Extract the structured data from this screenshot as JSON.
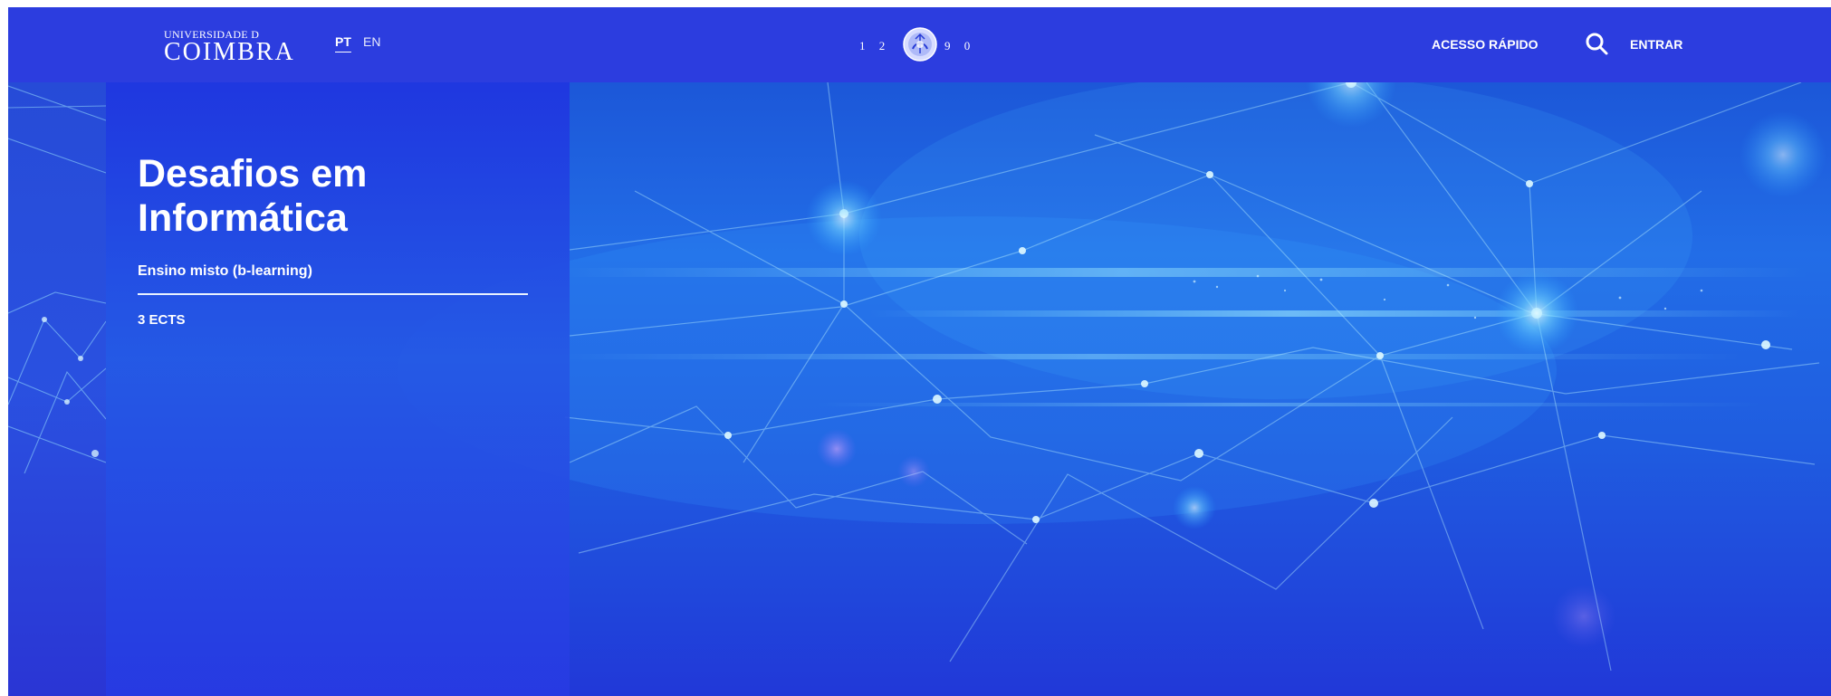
{
  "colors": {
    "header_background": "#2c3ddf",
    "hero_primary": "#226de7",
    "hero_dark": "#2138d8",
    "text": "#ffffff"
  },
  "header": {
    "university_top": "UNIVERSIDADE D",
    "university_name": "COIMBRA",
    "languages": {
      "active": "PT",
      "alternate": "EN"
    },
    "founding_year": {
      "left": "1 2",
      "right": "9 0"
    },
    "quick_access": "ACESSO RÁPIDO",
    "search_icon": "search-icon",
    "login": "ENTRAR"
  },
  "course": {
    "title_line_1": "Desafios em",
    "title_line_2": "Informática",
    "delivery_mode": "Ensino misto (b-learning)",
    "credits": "3 ECTS"
  }
}
